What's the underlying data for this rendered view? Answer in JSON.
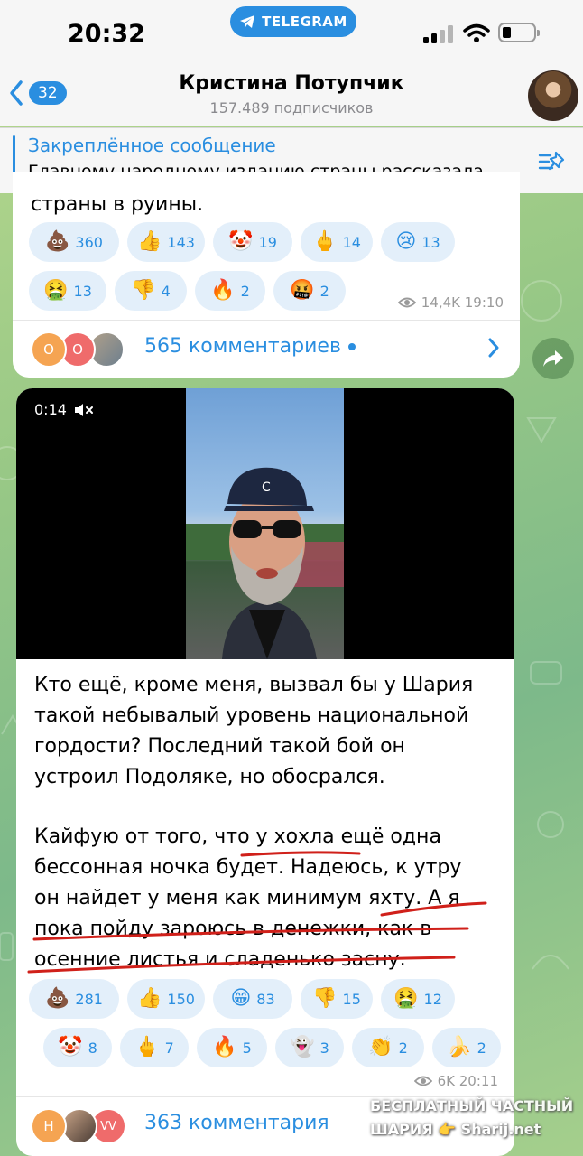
{
  "status_bar": {
    "time": "20:32",
    "app_pill": "TELEGRAM"
  },
  "header": {
    "back_count": "32",
    "title": "Кристина Потупчик",
    "subtitle": "157.489 подписчиков"
  },
  "pinned": {
    "title": "Закреплённое сообщение",
    "text": "Главному народному изданию страны рассказала..."
  },
  "message1": {
    "text_tail": "страны в руины.",
    "reactions_row1": [
      {
        "emoji": "💩",
        "count": "360"
      },
      {
        "emoji": "👍",
        "count": "143"
      },
      {
        "emoji": "🤡",
        "count": "19"
      },
      {
        "emoji": "🖕",
        "count": "14"
      },
      {
        "emoji": "😢",
        "count": "13"
      }
    ],
    "reactions_row2": [
      {
        "emoji": "🤮",
        "count": "13"
      },
      {
        "emoji": "👎",
        "count": "4"
      },
      {
        "emoji": "🔥",
        "count": "2"
      },
      {
        "emoji": "🤬",
        "count": "2"
      }
    ],
    "views_time": "14,4K 19:10",
    "comment_avatars": [
      "О",
      "О"
    ],
    "comments_label": "565 комментариев"
  },
  "message2": {
    "video_time": "0:14",
    "paragraph1": [
      "Кто ещё, кроме меня, вызвал бы у Шария",
      "такой небывалый уровень национальной",
      "гордости? Последний такой бой он",
      "устроил Подоляке, но обосрался."
    ],
    "paragraph2": [
      "Кайфую от того, что у хохла ещё одна",
      "бессонная ночка будет. Надеюсь, к утру",
      "он найдет у меня как минимум яхту. А я",
      "пока пойду зароюсь в денежки, как в",
      "осенние листья и сладенько засну."
    ],
    "reactions_row1": [
      {
        "emoji": "💩",
        "count": "281"
      },
      {
        "emoji": "👍",
        "count": "150"
      },
      {
        "emoji": "😁",
        "count": "83"
      },
      {
        "emoji": "👎",
        "count": "15"
      },
      {
        "emoji": "🤮",
        "count": "12"
      }
    ],
    "reactions_row2": [
      {
        "emoji": "🤡",
        "count": "8"
      },
      {
        "emoji": "🖕",
        "count": "7"
      },
      {
        "emoji": "🔥",
        "count": "5"
      },
      {
        "emoji": "👻",
        "count": "3"
      },
      {
        "emoji": "👏",
        "count": "2"
      },
      {
        "emoji": "🍌",
        "count": "2"
      }
    ],
    "views_time": "6K 20:11",
    "comment_avatars": [
      "Н",
      "",
      "VV"
    ],
    "comments_label": "363 комментария"
  },
  "watermark": {
    "line1": "БЕСПЛАТНЫЙ ЧАСТНЫЙ",
    "line2": "ШАРИЯ",
    "line2_suffix": "Sharij.net"
  },
  "colors": {
    "accent": "#2a8ee0",
    "reaction_bg": "#e3effa",
    "underline_red": "#d0201a"
  }
}
